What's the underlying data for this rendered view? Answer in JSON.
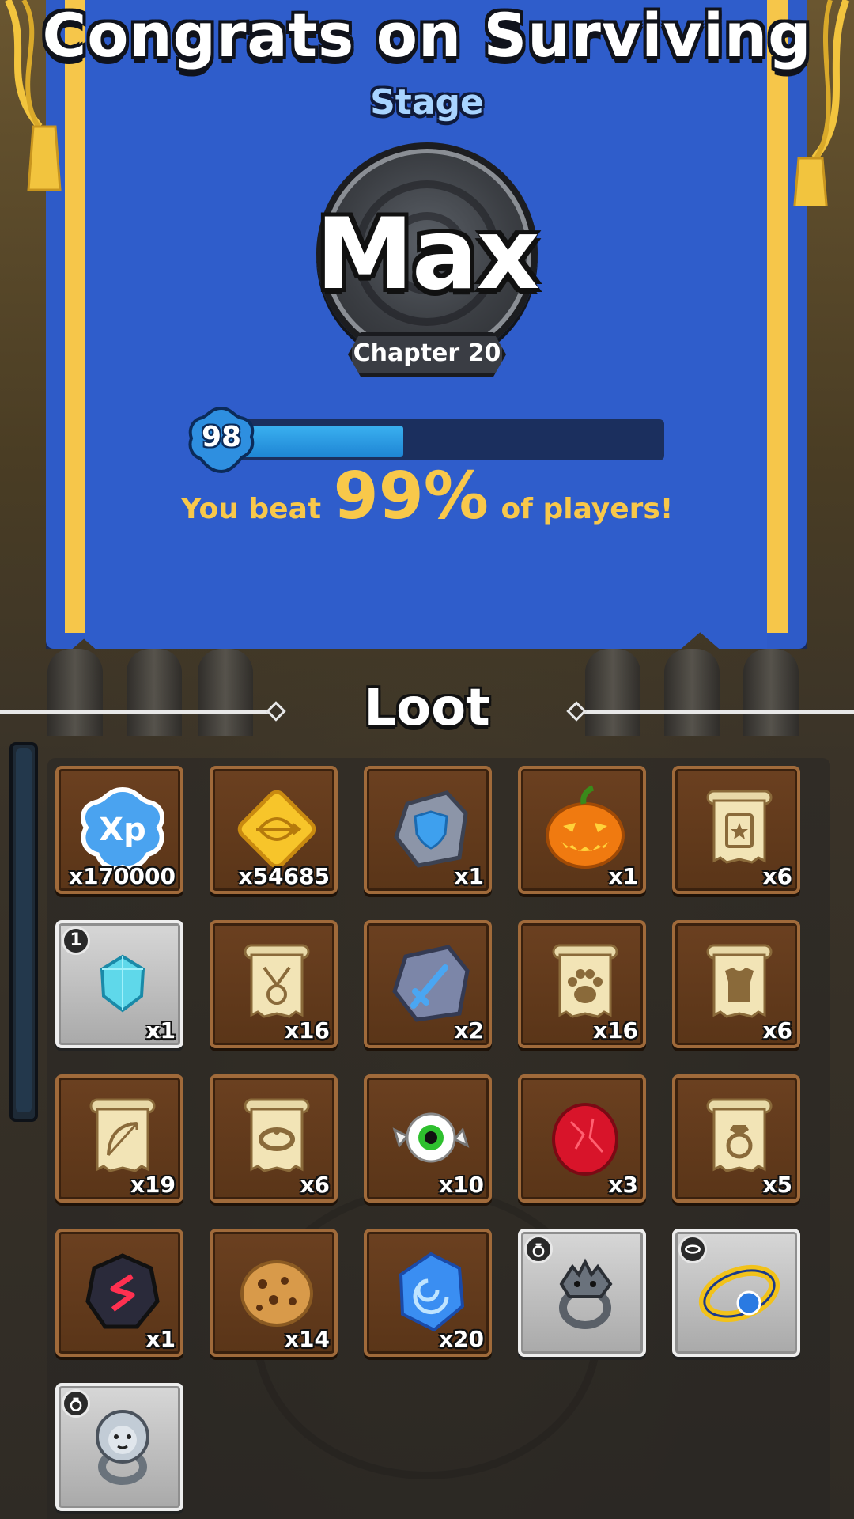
{
  "header": {
    "title": "Congrats on Surviving",
    "subtitle": "Stage",
    "stage_name": "Max",
    "chapter": "Chapter 20"
  },
  "progress": {
    "level": "98",
    "fill_fraction": 0.4
  },
  "result": {
    "prefix": "You beat",
    "percent": "99%",
    "suffix": "of players!"
  },
  "loot": {
    "title": "Loot",
    "items": [
      {
        "icon": "xp-icon",
        "quantity": "x170000",
        "frame": "common"
      },
      {
        "icon": "gold-bow-coin-icon",
        "quantity": "x54685",
        "frame": "common"
      },
      {
        "icon": "shield-stone-icon",
        "quantity": "x1",
        "frame": "common"
      },
      {
        "icon": "jack-o-lantern-icon",
        "quantity": "x1",
        "frame": "common"
      },
      {
        "icon": "book-scroll-icon",
        "quantity": "x6",
        "frame": "common"
      },
      {
        "icon": "gem-icon",
        "quantity": "x1",
        "frame": "gear",
        "badge": "1"
      },
      {
        "icon": "amulet-scroll-icon",
        "quantity": "x16",
        "frame": "common"
      },
      {
        "icon": "sword-stone-icon",
        "quantity": "x2",
        "frame": "common"
      },
      {
        "icon": "paw-scroll-icon",
        "quantity": "x16",
        "frame": "common"
      },
      {
        "icon": "armor-scroll-icon",
        "quantity": "x6",
        "frame": "common"
      },
      {
        "icon": "bow-scroll-icon",
        "quantity": "x19",
        "frame": "common"
      },
      {
        "icon": "bracelet-scroll-icon",
        "quantity": "x6",
        "frame": "common"
      },
      {
        "icon": "eye-candy-icon",
        "quantity": "x10",
        "frame": "common"
      },
      {
        "icon": "red-orb-icon",
        "quantity": "x3",
        "frame": "common"
      },
      {
        "icon": "ring-scroll-icon",
        "quantity": "x5",
        "frame": "common"
      },
      {
        "icon": "dark-rune-icon",
        "quantity": "x1",
        "frame": "common"
      },
      {
        "icon": "cookie-icon",
        "quantity": "x14",
        "frame": "common"
      },
      {
        "icon": "blue-crystal-icon",
        "quantity": "x20",
        "frame": "common"
      },
      {
        "icon": "dragon-ring-icon",
        "quantity": "",
        "frame": "gear",
        "badge_icon": "ring"
      },
      {
        "icon": "gold-bracelet-icon",
        "quantity": "",
        "frame": "gear",
        "badge_icon": "bracelet"
      },
      {
        "icon": "lion-ring-icon",
        "quantity": "",
        "frame": "gear",
        "badge_icon": "ring"
      }
    ]
  },
  "colors": {
    "banner": "#2f5dcb",
    "banner_trim": "#f6c64a",
    "accent_text": "#f8c84a",
    "xp_fill": "#2a9be6"
  }
}
